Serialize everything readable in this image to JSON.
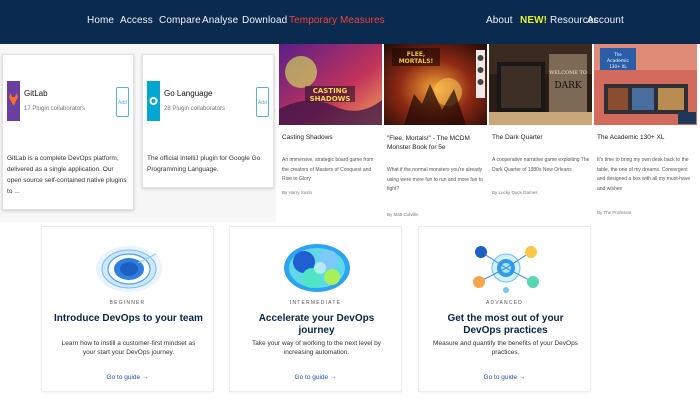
{
  "nav": {
    "left_items": [
      "Home",
      "Access",
      "Compare",
      "Analyse",
      "Download"
    ],
    "active_item": "Temporary Measures",
    "right_items": [
      "About",
      "Resources",
      "Account"
    ],
    "new_badge": "NEW!"
  },
  "plugins": [
    {
      "name": "GitLab",
      "stats": "17 Plugin collaborators",
      "button": "Add",
      "description": "GitLab is a complete DevOps platform, delivered as a single application. Our open source self-contained native plugins to ..."
    },
    {
      "name": "Go Language",
      "stats": "28 Plugin collaborators",
      "button": "Add",
      "description": "The official IntelliJ plugin for Google Go Programming Language."
    }
  ],
  "books": [
    {
      "title": "Casting Shadows",
      "description": "An immersive, strategic board game from the creators of Masters of Conquest and Rise to Glory",
      "author": "By Harry Suslo"
    },
    {
      "title": "\"Flee, Mortals!\" - The MCDM Monster Book for 5e",
      "description": "What if the normal monsters you're already using were more fun to run and more fun to fight?",
      "author": "By Matt Colville"
    },
    {
      "title": "The Dark Quarter",
      "description": "A cooperative narrative game exploiting The Dark Quarter of 1980s New Orleans",
      "author": "By Lucky Duck Games"
    },
    {
      "title": "The Academic 130+ XL",
      "description": "It's time to bring my own desk back to the table, the one of my dreams. Convergent and designed a box with all my must-have and wishes",
      "author": "By The Professor"
    }
  ],
  "devops": [
    {
      "level": "BEGINNER",
      "title": "Introduce DevOps to your team",
      "description": "Learn how to instill a customer-first mindset as your start your DevOps journey.",
      "link": "Go to guide →"
    },
    {
      "level": "INTERMEDIATE",
      "title": "Accelerate your DevOps journey",
      "description": "Take your way of working to the next level by increasing automation.",
      "link": "Go to guide →"
    },
    {
      "level": "ADVANCED",
      "title": "Get the most out of your DevOps practices",
      "description": "Measure and quantify the benefits of your DevOps practices.",
      "link": "Go to guide →"
    }
  ],
  "colors": {
    "nav_bg": "#0b2a4f",
    "active": "#f0433a",
    "new_badge": "#e8f21f",
    "dv_title": "#0a2540",
    "dv_link": "#1d50b5"
  }
}
